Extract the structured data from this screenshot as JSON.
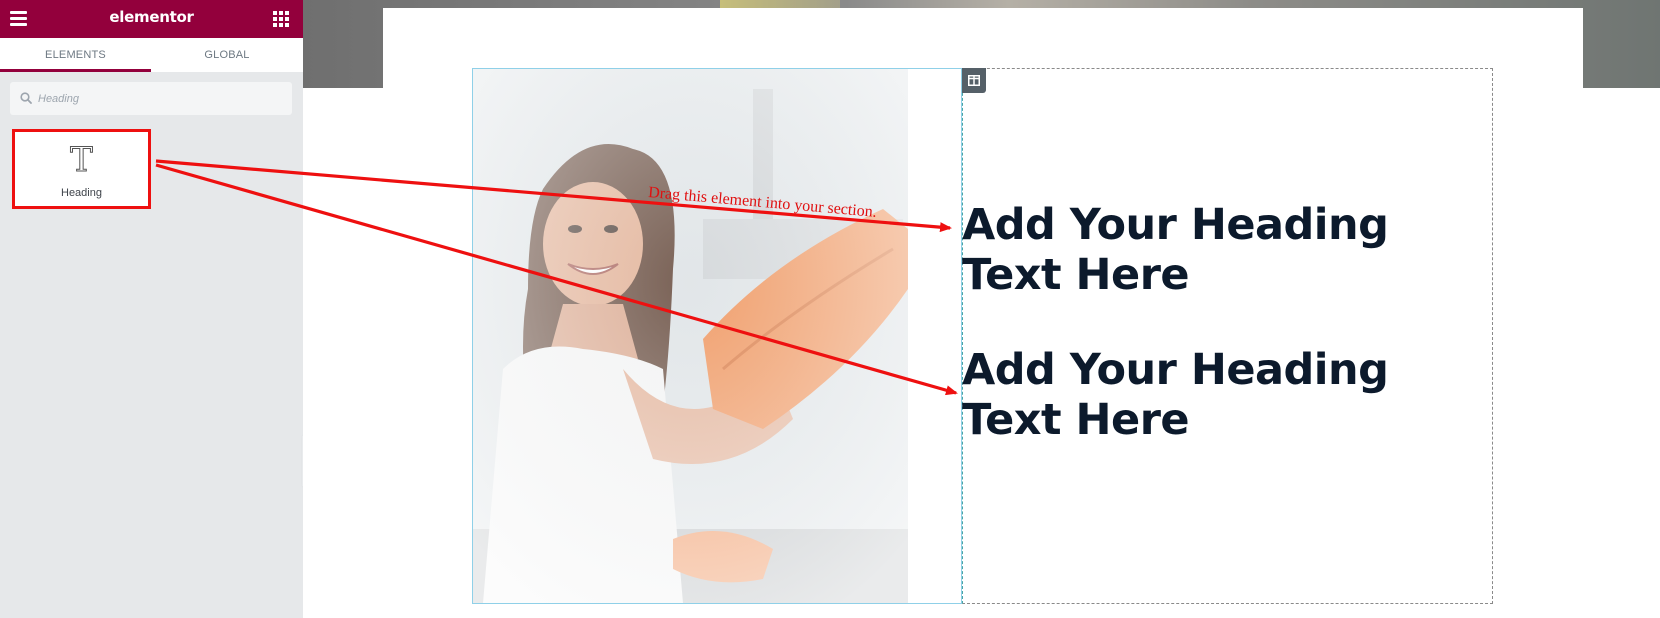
{
  "panel": {
    "logo": "elementor",
    "menu_icon": "hamburger-menu-icon",
    "apps_icon": "grid-apps-icon",
    "brand_color": "#93003c",
    "tabs": [
      {
        "label": "ELEMENTS",
        "active": true
      },
      {
        "label": "GLOBAL",
        "active": false
      }
    ],
    "search": {
      "value": "",
      "placeholder": "Heading",
      "icon": "search-icon"
    },
    "widgets": [
      {
        "label": "Heading",
        "icon": "heading-T-icon",
        "highlight_color": "#ee1010"
      }
    ],
    "collapse_icon": "chevron-left-icon"
  },
  "canvas": {
    "column_handle_icon": "column-layout-icon",
    "image_alt": "Smiling woman in white top wiping a soapy window with an orange cloth",
    "annotation": {
      "text": "Drag this element into your section.",
      "color": "#e01010"
    },
    "headings": [
      {
        "text": "Add Your Heading Text Here"
      },
      {
        "text": "Add Your Heading Text Here"
      }
    ],
    "heading_color": "#0c1a2c"
  }
}
